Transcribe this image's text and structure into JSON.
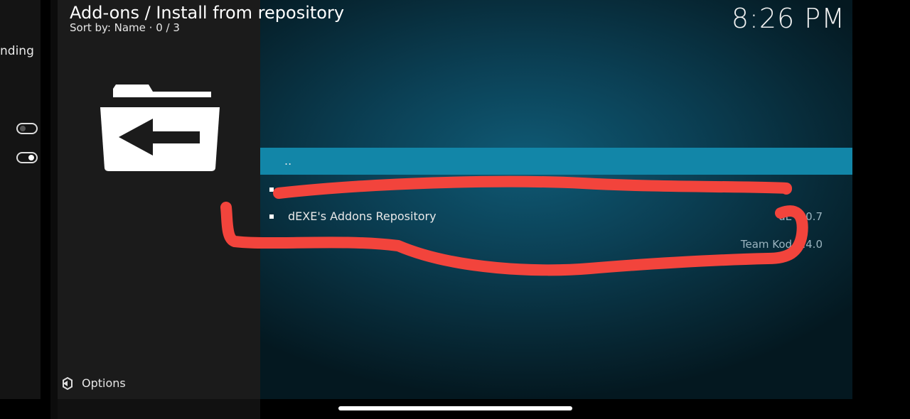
{
  "background_panel": {
    "partial_text": "nding"
  },
  "header": {
    "title": "Add-ons / Install from repository",
    "sort_label": "Sort by: Name  ·  0 / 3",
    "clock": "8:26 PM"
  },
  "list": {
    "items": [
      {
        "label": "..",
        "meta": "",
        "selected": true
      },
      {
        "label": "",
        "meta": "",
        "selected": false
      },
      {
        "label": "dEXE's Addons Repository",
        "meta": "dE      1.0.7",
        "selected": false
      },
      {
        "label": "",
        "meta": "Team Kod     3.4.0",
        "selected": false
      }
    ]
  },
  "footer": {
    "options_label": "Options"
  },
  "colors": {
    "selected_row": "#1286a8",
    "annotation_red": "#f2443c"
  },
  "icons": {
    "folder": "folder-back-icon",
    "options": "options-gear-icon"
  }
}
